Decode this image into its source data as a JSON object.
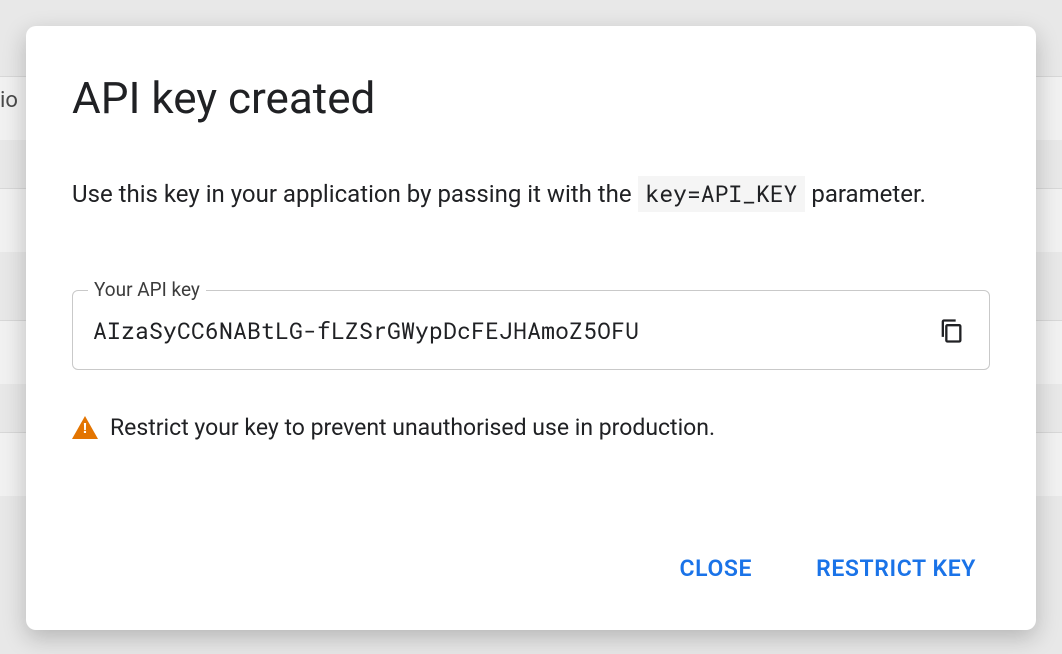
{
  "background": {
    "cut_label": "io"
  },
  "dialog": {
    "title": "API key created",
    "description_pre": "Use this key in your application by passing it with the ",
    "description_code": "key=API_KEY",
    "description_post": " parameter.",
    "field_label": "Your API key",
    "api_key": "AIzaSyCC6NABtLG-fLZSrGWypDcFEJHAmoZ5OFU",
    "copy_icon": "copy-icon",
    "restrict_warning": "Restrict your key to prevent unauthorised use in production.",
    "actions": {
      "close": "CLOSE",
      "restrict": "RESTRICT KEY"
    }
  },
  "colors": {
    "accent": "#1a73e8",
    "warning": "#e37400"
  }
}
